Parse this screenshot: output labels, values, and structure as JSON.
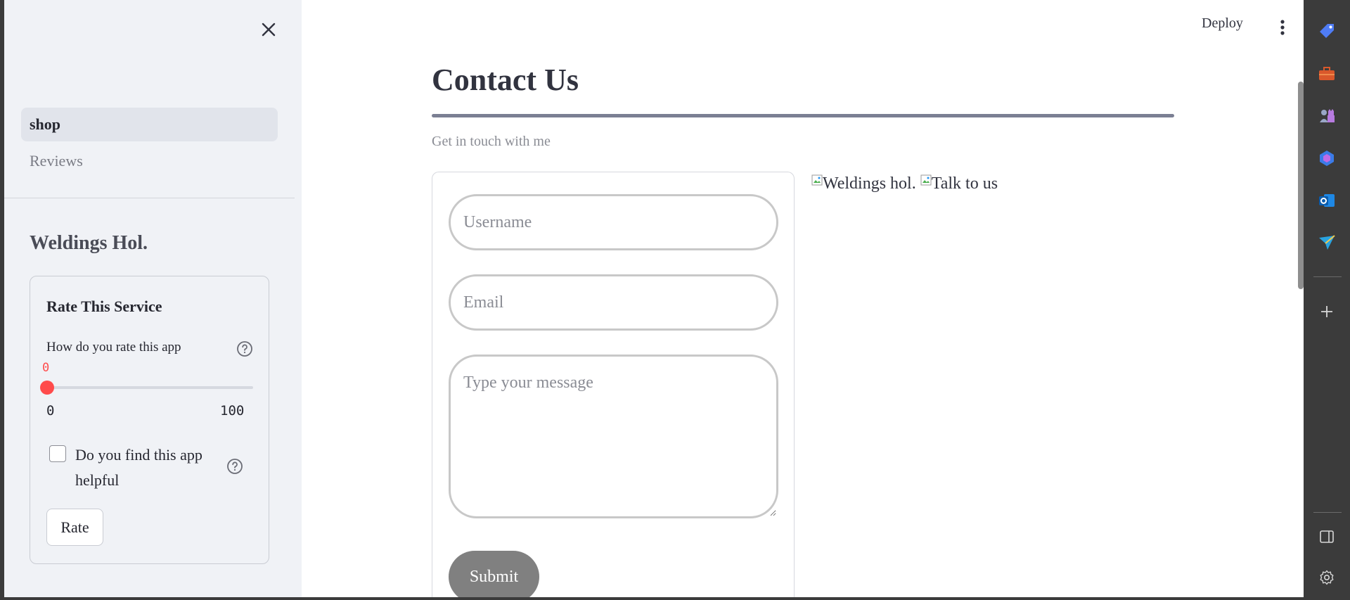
{
  "sidebar": {
    "nav": [
      {
        "label": "shop",
        "active": true
      },
      {
        "label": "Reviews",
        "active": false
      }
    ],
    "brand_title": "Weldings Hol.",
    "rate_card": {
      "title": "Rate This Service",
      "question": "How do you rate this app",
      "slider": {
        "value": "0",
        "min": "0",
        "max": "100",
        "fraction": 0
      },
      "checkbox_label": "Do you find this app helpful",
      "checkbox_checked": false,
      "rate_button": "Rate"
    }
  },
  "header": {
    "deploy_label": "Deploy"
  },
  "main": {
    "title": "Contact Us",
    "subtitle": "Get in touch with me",
    "form": {
      "username_placeholder": "Username",
      "email_placeholder": "Email",
      "message_placeholder": "Type your message",
      "submit_label": "Submit"
    },
    "images": [
      {
        "alt": "Weldings hol."
      },
      {
        "alt": "Talk to us"
      }
    ]
  },
  "colors": {
    "accent": "#ff4b4b",
    "sidebar_bg": "#f0f2f6",
    "submit_bg": "#808080"
  },
  "edge_icons": [
    "tag-icon",
    "toolbox-icon",
    "chess-icon",
    "copilot-icon",
    "outlook-icon",
    "send-icon",
    "add-icon",
    "sidebar-toggle-icon",
    "settings-icon"
  ]
}
